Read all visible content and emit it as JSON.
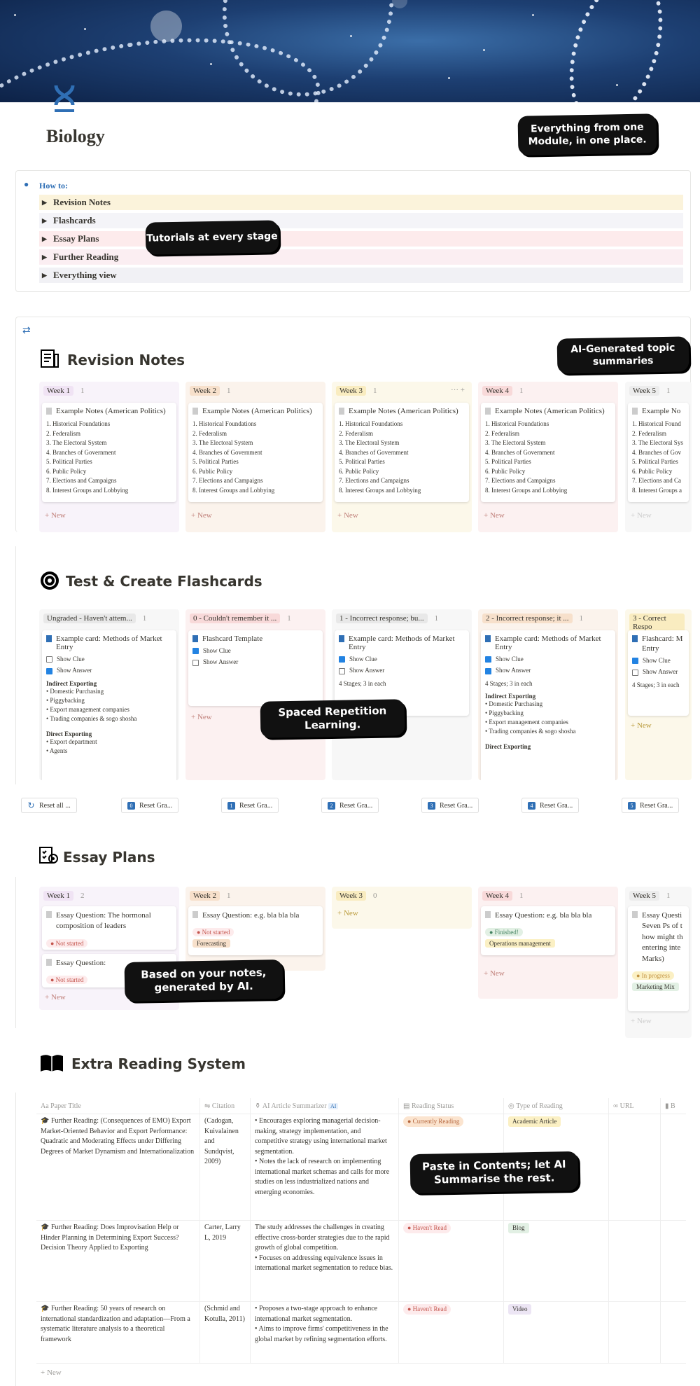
{
  "page": {
    "title": "Biology"
  },
  "callouts": {
    "top": "Everything from one Module, in one place.",
    "tutorials": "Tutorials at every stage",
    "ai_topic": "AI-Generated topic summaries",
    "spaced": "Spaced Repetition Learning.",
    "based": "Based on your notes, generated by AI.",
    "paste": "Paste in Contents; let AI Summarise the rest."
  },
  "howto": {
    "label": "How to:",
    "items": [
      "Revision Notes",
      "Flashcards",
      "Essay Plans",
      "Further Reading",
      "Everything view"
    ],
    "colors": [
      "#fbf3db",
      "#f4f4f8",
      "#fdebec",
      "#fbeef2",
      "#f1f1f5"
    ]
  },
  "revision": {
    "title": "Revision Notes",
    "new_label": "+ New",
    "columns": [
      {
        "name": "Week 1",
        "count": "1",
        "bg": "#f8f3fa",
        "tag": "#f0e3f4"
      },
      {
        "name": "Week 2",
        "count": "1",
        "bg": "#fbf3ec",
        "tag": "#f7e0cb"
      },
      {
        "name": "Week 3",
        "count": "1",
        "bg": "#fcf8ea",
        "tag": "#f9ecc0"
      },
      {
        "name": "Week 4",
        "count": "1",
        "bg": "#fcf1f1",
        "tag": "#f8d9d9"
      },
      {
        "name": "Week 5",
        "count": "1",
        "bg": "#f7f7f7",
        "tag": "#ececec"
      }
    ],
    "card_title": "Example Notes (American Politics)",
    "card_title_short": "Example No",
    "card_items": [
      "1. Historical Foundations",
      "2. Federalism",
      "3. The Electoral System",
      "4. Branches of Government",
      "5. Political Parties",
      "6. Public Policy",
      "7. Elections and Campaigns",
      "8. Interest Groups and Lobbying"
    ],
    "card_items_short": [
      "1. Historical Found",
      "2. Federalism",
      "3. The Electoral Sys",
      "4. Branches of Gov",
      "5. Political Parties",
      "6. Public Policy",
      "7. Elections and Ca",
      "8. Interest Groups a"
    ]
  },
  "flashcards": {
    "title": "Test & Create Flashcards",
    "columns": [
      {
        "name": "Ungraded - Haven't attem...",
        "count": "1",
        "bg": "#f7f7f7",
        "tag": "#e8e8e8"
      },
      {
        "name": "0 - Couldn't remember it ...",
        "count": "1",
        "bg": "#fcf1f1",
        "tag": "#f8d9d9"
      },
      {
        "name": "1 - Incorrect response; bu...",
        "count": "1",
        "bg": "#f7f7f7",
        "tag": "#e8e8e8"
      },
      {
        "name": "2 - Incorrect response; it ...",
        "count": "1",
        "bg": "#fbf3ec",
        "tag": "#f7e0cb"
      },
      {
        "name": "3 - Correct Respo",
        "count": "",
        "bg": "#fcf8ea",
        "tag": "#f9ecc0"
      }
    ],
    "card1": {
      "title": "Example card: Methods of Market Entry",
      "clue": "Show Clue",
      "answer": "Show Answer",
      "h1": "Indirect Exporting",
      "l1": [
        "• Domestic Purchasing",
        "• Piggybacking",
        "• Export management companies",
        "• Trading companies & sogo shosha"
      ],
      "h2": "Direct Exporting",
      "l2": [
        "• Export department",
        "• Agents"
      ]
    },
    "card2": {
      "title": "Flashcard Template",
      "clue": "Show Clue",
      "answer": "Show Answer"
    },
    "card3": {
      "title": "Example card: Methods of Market Entry",
      "clue": "Show Clue",
      "answer": "Show Answer",
      "stages": "4 Stages; 3 in each"
    },
    "card4": {
      "title": "Example card: Methods of Market Entry",
      "clue": "Show Clue",
      "answer": "Show Answer",
      "stages": "4 Stages; 3 in each",
      "h1": "Indirect Exporting",
      "l1": [
        "• Domestic Purchasing",
        "• Piggybacking",
        "• Export management companies",
        "• Trading companies & sogo shosha"
      ],
      "h2": "Direct Exporting"
    },
    "card5": {
      "title": "Flashcard: M",
      "title2": "Entry",
      "clue": "Show Clue",
      "answer": "Show Answer",
      "stages": "4 Stages; 3 in each"
    },
    "new_label": "+ New"
  },
  "resets": [
    "Reset all ...",
    "Reset Gra...",
    "Reset Gra...",
    "Reset Gra...",
    "Reset Gra...",
    "Reset Gra...",
    "Reset Gra..."
  ],
  "reset_nums": [
    "",
    "0",
    "1",
    "2",
    "3",
    "4",
    "5"
  ],
  "essays": {
    "title": "Essay Plans",
    "columns": [
      {
        "name": "Week 1",
        "count": "2",
        "bg": "#f8f3fa",
        "tag": "#f0e3f4"
      },
      {
        "name": "Week 2",
        "count": "1",
        "bg": "#fbf3ec",
        "tag": "#f7e0cb"
      },
      {
        "name": "Week 3",
        "count": "0",
        "bg": "#fcf8ea",
        "tag": "#f9ecc0"
      },
      {
        "name": "Week 4",
        "count": "1",
        "bg": "#fcf1f1",
        "tag": "#f8d9d9"
      },
      {
        "name": "Week 5",
        "count": "1",
        "bg": "#f7f7f7",
        "tag": "#ececec"
      }
    ],
    "c1": {
      "title": "Essay Question: The hormonal composition of leaders",
      "status": "Not started"
    },
    "c1b": {
      "title": "Essay Question:",
      "status": "Not started"
    },
    "c2": {
      "title": "Essay Question: e.g. bla bla bla",
      "status": "Not started",
      "tag": "Forecasting"
    },
    "c4": {
      "title": "Essay Question: e.g. bla bla bla",
      "status": "Finished!",
      "tag": "Operations management"
    },
    "c5": {
      "title": "Essay Questi Seven Ps of t how might th entering inte Marks)",
      "status": "In progress",
      "tag": "Marketing Mix"
    },
    "new_label": "+ New"
  },
  "reading": {
    "title": "Extra Reading System",
    "headers": [
      "Paper Title",
      "Citation",
      "AI Article Summarizer",
      "Reading Status",
      "Type of Reading",
      "URL",
      "B"
    ],
    "ai_badge": "AI",
    "rows": [
      {
        "title": "Further Reading: (Consequences of EMO) Export Market-Oriented Behavior and Export Performance: Quadratic and Moderating Effects under Differing Degrees of Market Dynamism and Internationalization",
        "citation": "(Cadogan, Kuivalainen and Sundqvist, 2009)",
        "summary": "• Encourages exploring managerial decision-making, strategy implementation, and competitive strategy using international market segmentation.\n• Notes the lack of research on implementing international market schemas and calls for more studies on less industrialized nations and emerging economies.",
        "status": "Currently Reading",
        "type": "Academic Article"
      },
      {
        "title": "Further Reading: Does Improvisation Help or Hinder Planning in Determining Export Success? Decision Theory Applied to Exporting",
        "citation": "Carter, Larry L, 2019",
        "summary": " The study addresses the challenges in creating effective cross-border strategies due to the rapid growth of global competition.\n• Focuses on addressing equivalence issues in international market segmentation to reduce bias.",
        "status": "Haven't Read",
        "type": "Blog"
      },
      {
        "title": "Further Reading: 50 years of research on international standardization and adaptation—From a systematic literature analysis to a theoretical framework",
        "citation": "(Schmid and Kotulla, 2011)",
        "summary": "• Proposes a two-stage approach to enhance international market segmentation.\n• Aims to improve firms' competitiveness in the global market by refining segmentation efforts.",
        "status": "Haven't Read",
        "type": "Video"
      }
    ],
    "new_label": "+ New"
  },
  "colors": {
    "accent": "#2f6fb5",
    "status_red": "#fdebec",
    "status_orange": "#fbe4cf",
    "status_green": "#e2f0e4",
    "status_yellow": "#fbf0c4",
    "type_yellow": "#fbf0c4",
    "type_green": "#e2f0e4",
    "type_purple": "#ece5f4"
  }
}
